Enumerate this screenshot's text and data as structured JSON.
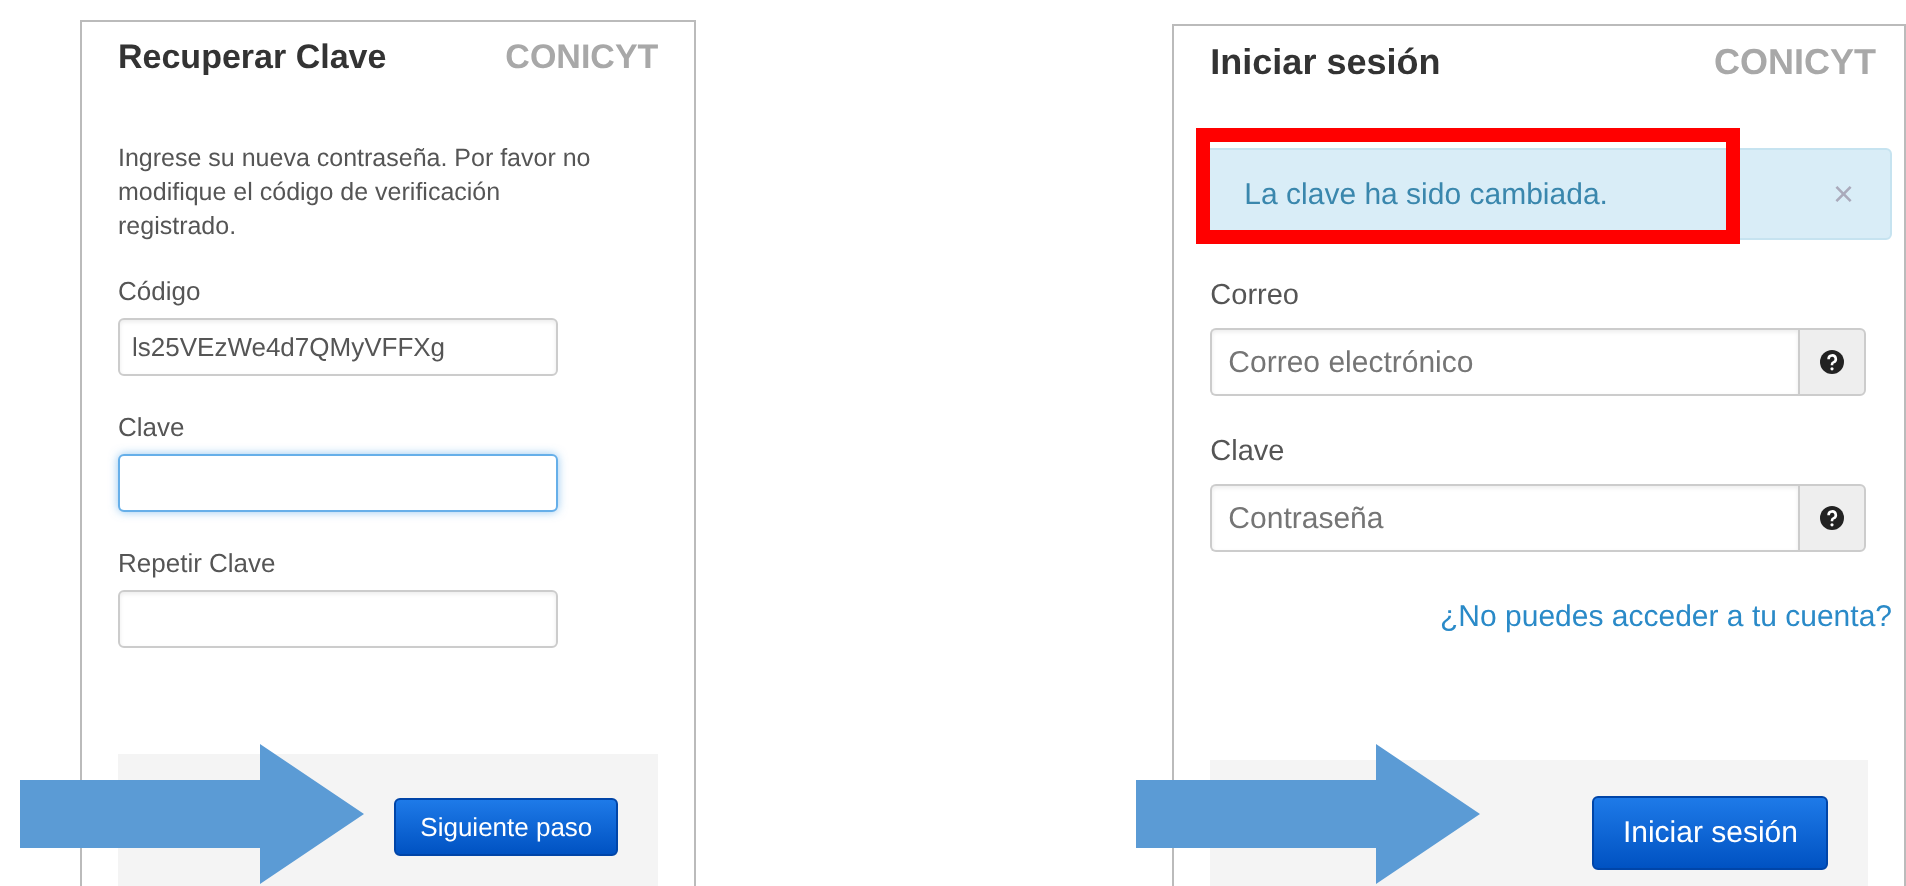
{
  "recover_panel": {
    "title": "Recuperar Clave",
    "brand": "CONICYT",
    "instructions": "Ingrese su nueva contraseña. Por favor no modifique el código de verificación registrado.",
    "fields": [
      {
        "label": "Código",
        "value": "ls25VEzWe4d7QMyVFFXg",
        "focused": false
      },
      {
        "label": "Clave",
        "focused": true
      },
      {
        "label": "Repetir Clave",
        "focused": false
      }
    ],
    "button": "Siguiente paso"
  },
  "login_panel": {
    "title": "Iniciar sesión",
    "brand": "CONICYT",
    "alert": {
      "message": "La clave ha sido cambiada.",
      "close": "×",
      "highlighted": true
    },
    "fields": [
      {
        "label": "Correo",
        "placeholder": "Correo electrónico"
      },
      {
        "label": "Clave",
        "placeholder": "Contraseña"
      }
    ],
    "link": "¿No puedes acceder a tu cuenta?",
    "button": "Iniciar sesión"
  }
}
